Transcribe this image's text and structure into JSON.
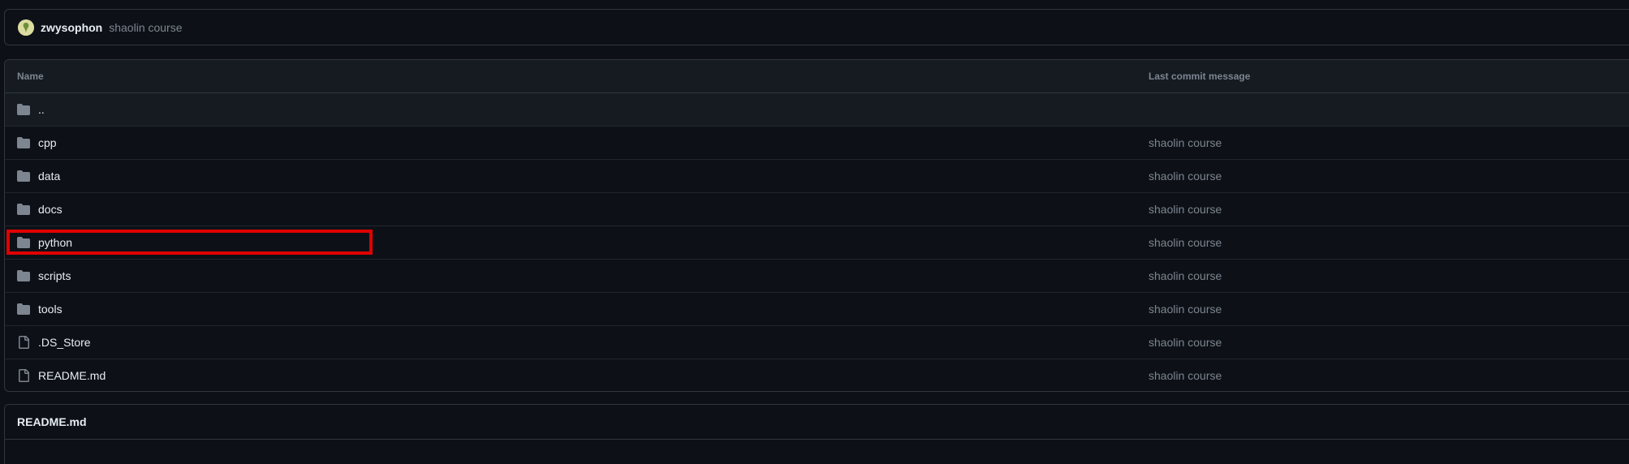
{
  "commit_bar": {
    "author": "zwysophon",
    "message": "shaolin course"
  },
  "table": {
    "headers": {
      "name": "Name",
      "last_commit": "Last commit message"
    },
    "parent": "..",
    "rows": [
      {
        "name": "cpp",
        "type": "folder",
        "message": "shaolin course"
      },
      {
        "name": "data",
        "type": "folder",
        "message": "shaolin course"
      },
      {
        "name": "docs",
        "type": "folder",
        "message": "shaolin course"
      },
      {
        "name": "python",
        "type": "folder",
        "message": "shaolin course"
      },
      {
        "name": "scripts",
        "type": "folder",
        "message": "shaolin course"
      },
      {
        "name": "tools",
        "type": "folder",
        "message": "shaolin course"
      },
      {
        "name": ".DS_Store",
        "type": "file",
        "message": "shaolin course"
      },
      {
        "name": "README.md",
        "type": "file",
        "message": "shaolin course"
      }
    ]
  },
  "readme": {
    "title": "README.md"
  },
  "colors": {
    "background": "#0d1117",
    "header_bg": "#161b22",
    "border": "#30363d",
    "muted_text": "#7d8590",
    "highlight": "#e00000"
  },
  "icons": {
    "folder": "folder-icon",
    "file": "file-icon"
  }
}
